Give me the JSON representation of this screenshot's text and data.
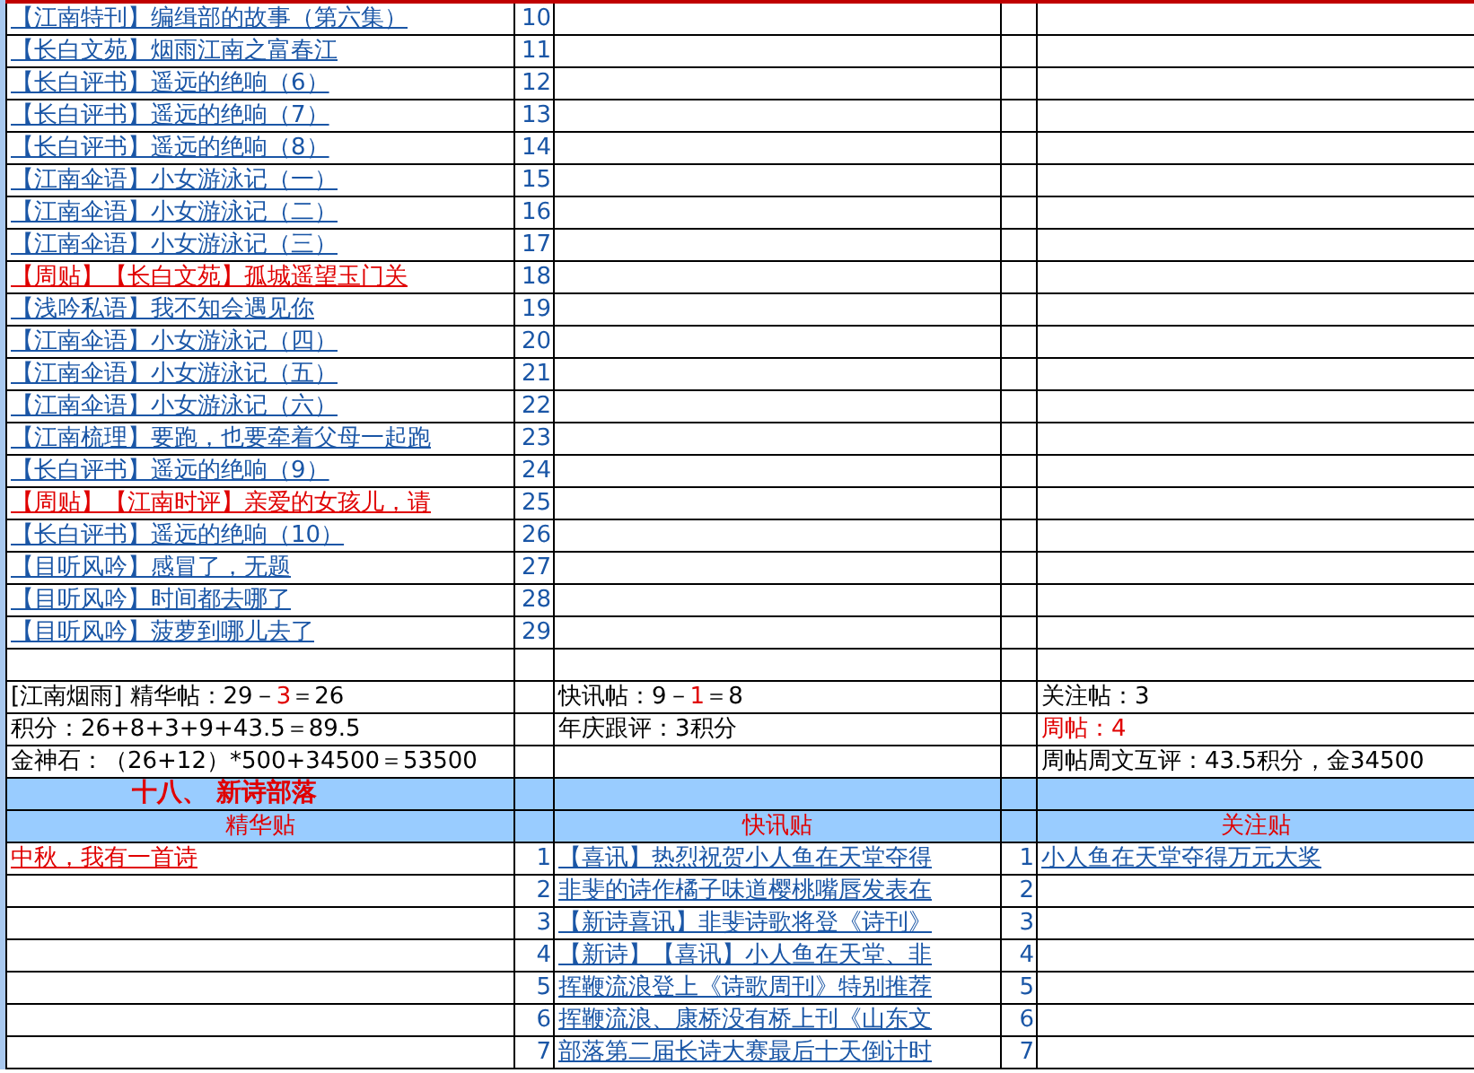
{
  "top_rows": [
    {
      "title": "【江南特刊】编缉部的故事（第六集）",
      "number": "10",
      "weekly": false
    },
    {
      "title": "【长白文苑】烟雨江南之富春江",
      "number": "11",
      "weekly": false
    },
    {
      "title": "【长白评书】遥远的绝响（6）",
      "number": "12",
      "weekly": false
    },
    {
      "title": "【长白评书】遥远的绝响（7）",
      "number": "13",
      "weekly": false
    },
    {
      "title": "【长白评书】遥远的绝响（8）",
      "number": "14",
      "weekly": false
    },
    {
      "title": "【江南伞语】小女游泳记（一）",
      "number": "15",
      "weekly": false
    },
    {
      "title": "【江南伞语】小女游泳记（二）",
      "number": "16",
      "weekly": false
    },
    {
      "title": "【江南伞语】小女游泳记（三）",
      "number": "17",
      "weekly": false
    },
    {
      "title": "【周贴】【长白文苑】孤城遥望玉门关",
      "number": "18",
      "weekly": true
    },
    {
      "title": "【浅吟私语】我不知会遇见你",
      "number": "19",
      "weekly": false
    },
    {
      "title": "【江南伞语】小女游泳记（四）",
      "number": "20",
      "weekly": false
    },
    {
      "title": "【江南伞语】小女游泳记（五）",
      "number": "21",
      "weekly": false
    },
    {
      "title": "【江南伞语】小女游泳记（六）",
      "number": "22",
      "weekly": false
    },
    {
      "title": "【江南梳理】要跑，也要牵着父母一起跑",
      "number": "23",
      "weekly": false
    },
    {
      "title": "【长白评书】遥远的绝响（9）",
      "number": "24",
      "weekly": false
    },
    {
      "title": "【周贴】【江南时评】亲爱的女孩儿，请",
      "number": "25",
      "weekly": true
    },
    {
      "title": "【长白评书】遥远的绝响（10）",
      "number": "26",
      "weekly": false
    },
    {
      "title": "【目听风吟】感冒了，无题",
      "number": "27",
      "weekly": false
    },
    {
      "title": "【目听风吟】时间都去哪了",
      "number": "28",
      "weekly": false
    },
    {
      "title": "【目听风吟】菠萝到哪儿去了",
      "number": "29",
      "weekly": false
    }
  ],
  "summary_rows": [
    [
      [
        {
          "text": "[江南烟雨] 精华帖：29－",
          "red": false
        },
        {
          "text": "3",
          "red": true
        },
        {
          "text": "＝26",
          "red": false
        }
      ],
      [
        {
          "text": "快讯帖：9－",
          "red": false
        },
        {
          "text": "1",
          "red": true
        },
        {
          "text": "＝8",
          "red": false
        }
      ],
      [
        {
          "text": "关注帖：3",
          "red": false
        }
      ]
    ],
    [
      [
        {
          "text": "积分：26+8+3+9+43.5＝89.5",
          "red": false
        }
      ],
      [
        {
          "text": "年庆跟评：3积分",
          "red": false
        }
      ],
      [
        {
          "text": "周帖：4",
          "red": true
        }
      ]
    ],
    [
      [
        {
          "text": "金神石：（26+12）*500+34500＝53500",
          "red": false
        }
      ],
      [],
      [
        {
          "text": "周帖周文互评：43.5积分，金34500",
          "red": false
        }
      ]
    ]
  ],
  "section": {
    "title": "十八、 新诗部落",
    "columns": [
      "精华贴",
      "快讯贴",
      "关注贴"
    ],
    "rows": [
      {
        "essence": {
          "text": "中秋，我有一首诗",
          "weekly": true
        },
        "news_number": "1",
        "news": "【喜讯】热烈祝贺小人鱼在天堂夺得",
        "focus_number": "1",
        "focus": "小人鱼在天堂夺得万元大奖"
      },
      {
        "news_number": "2",
        "news": "非斐的诗作橘子味道樱桃嘴唇发表在",
        "focus_number": "2"
      },
      {
        "news_number": "3",
        "news": "【新诗喜讯】非斐诗歌将登《诗刊》",
        "focus_number": "3"
      },
      {
        "news_number": "4",
        "news": "【新诗】【喜讯】小人鱼在天堂、非",
        "focus_number": "4"
      },
      {
        "news_number": "5",
        "news": "挥鞭流浪登上《诗歌周刊》特别推荐",
        "focus_number": "5"
      },
      {
        "news_number": "6",
        "news": "挥鞭流浪、康桥没有桥上刊《山东文",
        "focus_number": "6"
      },
      {
        "news_number": "7",
        "news": "部落第二届长诗大赛最后十天倒计时",
        "focus_number": "7"
      }
    ]
  }
}
